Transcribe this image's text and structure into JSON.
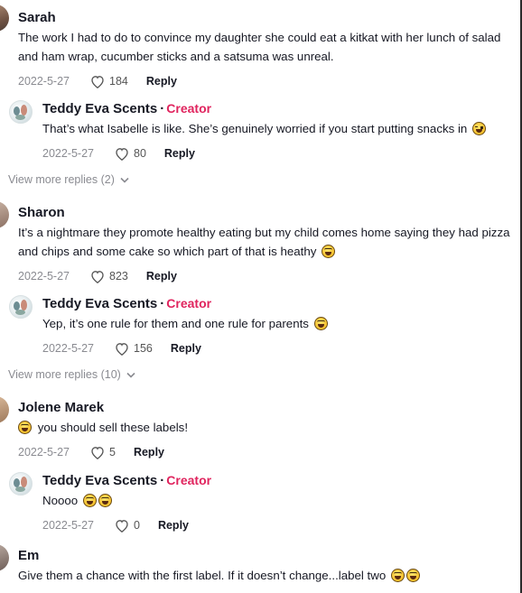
{
  "view_more_1": "View more replies (2)",
  "view_more_2": "View more replies (10)",
  "comments": [
    {
      "name": "Sarah",
      "text": "The work I had to do to convince my daughter she could eat a kitkat with her lunch of salad and ham wrap, cucumber sticks and a satsuma was unreal.",
      "date": "2022-5-27",
      "likes": "184",
      "reply_label": "Reply"
    },
    {
      "name": "Sharon",
      "text": "It’s a nightmare they promote healthy eating but my child comes home saying they had pizza and chips and some cake so which part of that is heathy",
      "date": "2022-5-27",
      "likes": "823",
      "reply_label": "Reply"
    },
    {
      "name": "Jolene Marek",
      "text": "you should sell these labels!",
      "date": "2022-5-27",
      "likes": "5",
      "reply_label": "Reply"
    },
    {
      "name": "Em",
      "text": "Give them a chance with the first label. If it doesn’t change...label two",
      "date": "",
      "likes": "",
      "reply_label": ""
    }
  ],
  "replies": [
    {
      "name": "Teddy Eva Scents",
      "separator": "·",
      "badge": "Creator",
      "text": "That’s what Isabelle is like. She’s genuinely worried if you start putting snacks in",
      "date": "2022-5-27",
      "likes": "80",
      "reply_label": "Reply"
    },
    {
      "name": "Teddy Eva Scents",
      "separator": "·",
      "badge": "Creator",
      "text": "Yep, it’s one rule for them and one rule for parents",
      "date": "2022-5-27",
      "likes": "156",
      "reply_label": "Reply"
    },
    {
      "name": "Teddy Eva Scents",
      "separator": "·",
      "badge": "Creator",
      "text": "Noooo",
      "date": "2022-5-27",
      "likes": "0",
      "reply_label": "Reply"
    }
  ],
  "colors": {
    "creator_badge": "#e0245e",
    "meta_gray": "#8a8b91",
    "text": "#161823"
  },
  "icons": [
    "heart-icon",
    "chevron-down-icon",
    "grinning-sweat-emoji",
    "grinning-squint-emoji"
  ]
}
